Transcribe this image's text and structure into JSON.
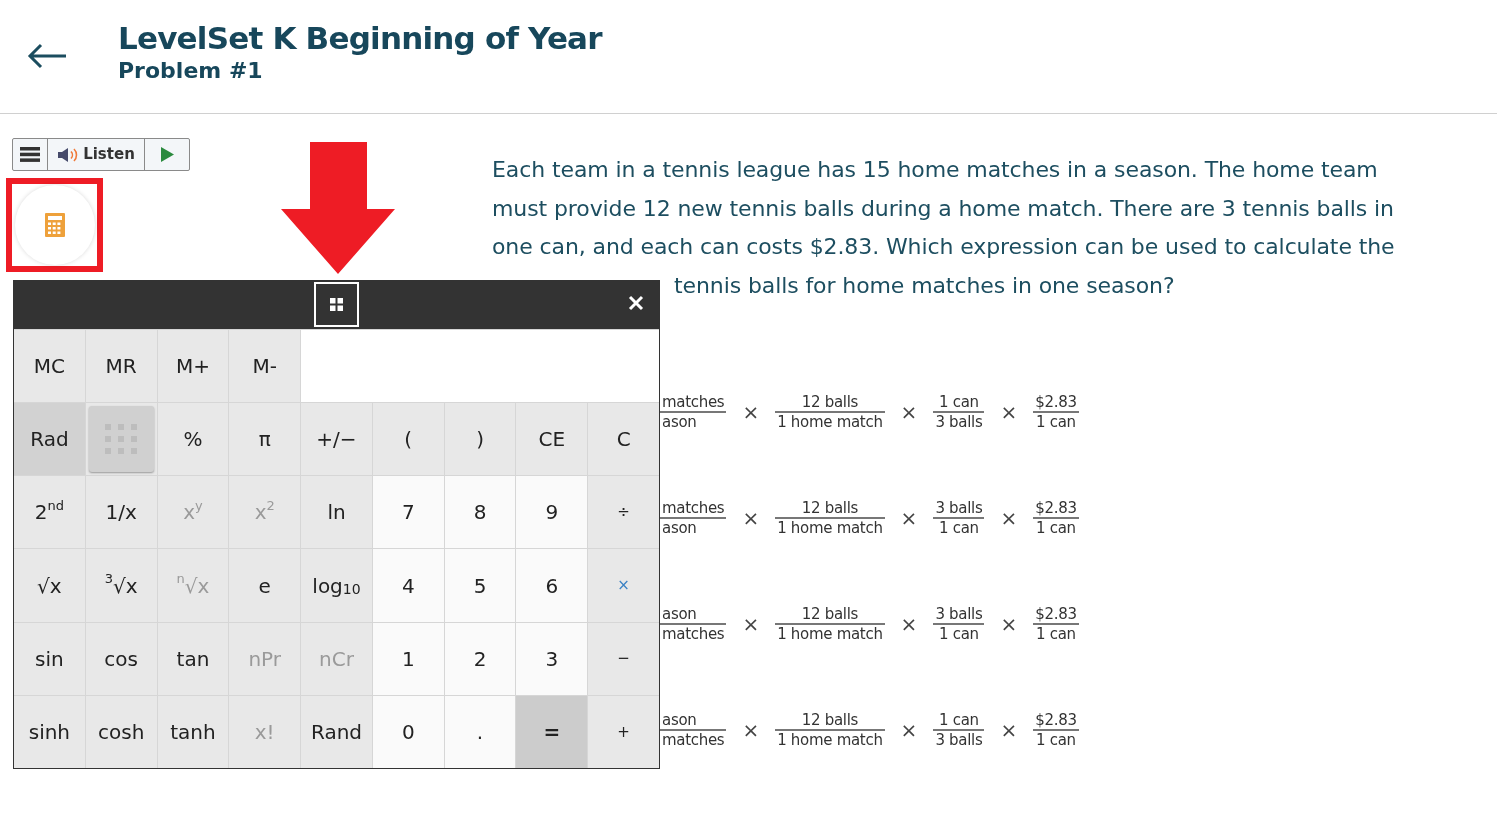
{
  "header": {
    "title": "LevelSet K Beginning of Year",
    "subtitle": "Problem #1"
  },
  "toolbar": {
    "listen_label": "Listen"
  },
  "question": {
    "text": "Each team in a tennis league has 15 home matches in a season. The home team must provide 12 new tennis balls during a home match. There are 3 tennis balls in one can, and each can costs $2.83. Which expression can be used to calculate the",
    "last_line_visible": "tennis balls for home matches in one season?"
  },
  "options": [
    {
      "terms": [
        {
          "kind": "fraction",
          "num": "matches",
          "den": "ason"
        },
        {
          "kind": "operator",
          "text": "×"
        },
        {
          "kind": "fraction",
          "num": "12 balls",
          "den": "1 home match"
        },
        {
          "kind": "operator",
          "text": "×"
        },
        {
          "kind": "fraction",
          "num": "1 can",
          "den": "3 balls"
        },
        {
          "kind": "operator",
          "text": "×"
        },
        {
          "kind": "fraction",
          "num": "$2.83",
          "den": "1 can"
        }
      ]
    },
    {
      "terms": [
        {
          "kind": "fraction",
          "num": "matches",
          "den": "ason"
        },
        {
          "kind": "operator",
          "text": "×"
        },
        {
          "kind": "fraction",
          "num": "12 balls",
          "den": "1 home match"
        },
        {
          "kind": "operator",
          "text": "×"
        },
        {
          "kind": "fraction",
          "num": "3 balls",
          "den": "1 can"
        },
        {
          "kind": "operator",
          "text": "×"
        },
        {
          "kind": "fraction",
          "num": "$2.83",
          "den": "1 can"
        }
      ]
    },
    {
      "terms": [
        {
          "kind": "fraction",
          "num": "ason",
          "den": "matches"
        },
        {
          "kind": "operator",
          "text": "×"
        },
        {
          "kind": "fraction",
          "num": "12 balls",
          "den": "1 home match"
        },
        {
          "kind": "operator",
          "text": "×"
        },
        {
          "kind": "fraction",
          "num": "3 balls",
          "den": "1 can"
        },
        {
          "kind": "operator",
          "text": "×"
        },
        {
          "kind": "fraction",
          "num": "$2.83",
          "den": "1 can"
        }
      ]
    },
    {
      "terms": [
        {
          "kind": "fraction",
          "num": "ason",
          "den": "matches"
        },
        {
          "kind": "operator",
          "text": "×"
        },
        {
          "kind": "fraction",
          "num": "12 balls",
          "den": "1 home match"
        },
        {
          "kind": "operator",
          "text": "×"
        },
        {
          "kind": "fraction",
          "num": "1 can",
          "den": "3 balls"
        },
        {
          "kind": "operator",
          "text": "×"
        },
        {
          "kind": "fraction",
          "num": "$2.83",
          "den": "1 can"
        }
      ]
    }
  ],
  "calculator": {
    "memory_keys": [
      {
        "label": "MC",
        "kind": "fn",
        "disabled": false
      },
      {
        "label": "MR",
        "kind": "fn",
        "disabled": false
      },
      {
        "label": "M+",
        "kind": "fn",
        "disabled": false
      },
      {
        "label": "M-",
        "kind": "fn",
        "disabled": false
      }
    ],
    "rows": [
      [
        {
          "label": "Rad",
          "kind": "mode",
          "disabled": false
        },
        {
          "kind": "toggle",
          "disabled": false
        },
        {
          "label": "%",
          "kind": "fn",
          "disabled": false
        },
        {
          "label": "π",
          "kind": "fn",
          "disabled": false
        },
        {
          "label": "+/−",
          "kind": "fn",
          "disabled": false
        },
        {
          "label": "(",
          "kind": "fn",
          "disabled": false
        },
        {
          "label": ")",
          "kind": "fn",
          "disabled": false
        },
        {
          "label": "CE",
          "kind": "fn",
          "disabled": false
        },
        {
          "label": "C",
          "kind": "fn",
          "disabled": false
        }
      ],
      [
        {
          "label": "2$^{nd}$",
          "kind": "fn",
          "disabled": false
        },
        {
          "label": "1/x",
          "kind": "fn",
          "disabled": false
        },
        {
          "label": "x$^{y}$",
          "kind": "fn",
          "disabled": true
        },
        {
          "label": "x$^{2}$",
          "kind": "fn",
          "disabled": true
        },
        {
          "label": "ln",
          "kind": "fn",
          "disabled": false
        },
        {
          "label": "7",
          "kind": "digit",
          "disabled": false
        },
        {
          "label": "8",
          "kind": "digit",
          "disabled": false
        },
        {
          "label": "9",
          "kind": "digit",
          "disabled": false
        },
        {
          "label": "÷",
          "kind": "op",
          "disabled": false
        }
      ],
      [
        {
          "label": "√x",
          "kind": "fn",
          "disabled": false
        },
        {
          "label": "$^{3}$√x",
          "kind": "fn",
          "disabled": false
        },
        {
          "label": "$^{n}$√x",
          "kind": "fn",
          "disabled": true
        },
        {
          "label": "e",
          "kind": "fn",
          "disabled": false
        },
        {
          "label": "log$_{10}$",
          "kind": "fn",
          "disabled": false
        },
        {
          "label": "4",
          "kind": "digit",
          "disabled": false
        },
        {
          "label": "5",
          "kind": "digit",
          "disabled": false
        },
        {
          "label": "6",
          "kind": "digit",
          "disabled": false
        },
        {
          "label": "×",
          "kind": "op",
          "disabled": false
        }
      ],
      [
        {
          "label": "sin",
          "kind": "fn",
          "disabled": false
        },
        {
          "label": "cos",
          "kind": "fn",
          "disabled": false
        },
        {
          "label": "tan",
          "kind": "fn",
          "disabled": false
        },
        {
          "label": "nPr",
          "kind": "fn",
          "disabled": true
        },
        {
          "label": "nCr",
          "kind": "fn",
          "disabled": true
        },
        {
          "label": "1",
          "kind": "digit",
          "disabled": false
        },
        {
          "label": "2",
          "kind": "digit",
          "disabled": false
        },
        {
          "label": "3",
          "kind": "digit",
          "disabled": false
        },
        {
          "label": "−",
          "kind": "op",
          "disabled": false
        }
      ],
      [
        {
          "label": "sinh",
          "kind": "fn",
          "disabled": false
        },
        {
          "label": "cosh",
          "kind": "fn",
          "disabled": false
        },
        {
          "label": "tanh",
          "kind": "fn",
          "disabled": false
        },
        {
          "label": "x!",
          "kind": "fn",
          "disabled": true
        },
        {
          "label": "Rand",
          "kind": "fn",
          "disabled": false
        },
        {
          "label": "0",
          "kind": "digit",
          "disabled": false
        },
        {
          "label": ".",
          "kind": "digit",
          "disabled": false
        },
        {
          "label": "=",
          "kind": "equals",
          "disabled": false
        },
        {
          "label": "+",
          "kind": "op",
          "disabled": false
        }
      ]
    ]
  }
}
